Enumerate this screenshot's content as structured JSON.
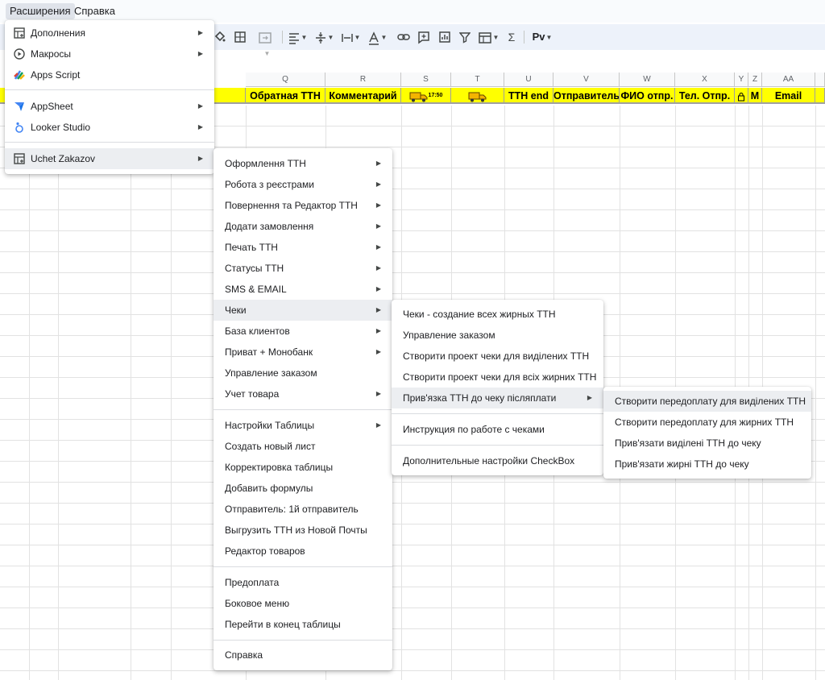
{
  "menubar": {
    "extensions": "Расширения",
    "help": "Справка"
  },
  "toolbar": {
    "format_text": "Рv"
  },
  "columns": {
    "headers": [
      "Q",
      "R",
      "S",
      "T",
      "U",
      "V",
      "W",
      "X",
      "Y",
      "Z",
      "AA"
    ],
    "header_values": [
      "Обратная ТТН",
      "Комментарий",
      "17:50",
      "",
      "ТТН end",
      "Отправитель",
      "ФИО отпр.",
      "Тел. Отпр.",
      "",
      "М",
      "Email"
    ]
  },
  "colors": {
    "header_fill": "#ffff00",
    "menu_highlight": "#eceef1"
  },
  "ext_menu": {
    "items": [
      {
        "label": "Дополнения",
        "icon": "addon-icon",
        "submenu": true
      },
      {
        "label": "Макросы",
        "icon": "macro-icon",
        "submenu": true
      },
      {
        "label": "Apps Script",
        "icon": "apps-script-icon",
        "submenu": false
      },
      {
        "label": "AppSheet",
        "icon": "appsheet-icon",
        "submenu": true
      },
      {
        "label": "Looker Studio",
        "icon": "looker-studio-icon",
        "submenu": true
      },
      {
        "label": "Uchet Zakazov",
        "icon": "addon-icon",
        "submenu": true
      }
    ]
  },
  "uchet_menu": {
    "items": [
      {
        "label": "Оформлення ТТН",
        "submenu": true
      },
      {
        "label": "Робота з реєстрами",
        "submenu": true
      },
      {
        "label": "Повернення та Редактор ТТН",
        "submenu": true
      },
      {
        "label": "Додати замовлення",
        "submenu": true
      },
      {
        "label": "Печать ТТН",
        "submenu": true
      },
      {
        "label": "Статусы ТТН",
        "submenu": true
      },
      {
        "label": "SMS & EMAIL",
        "submenu": true
      },
      {
        "label": "Чеки",
        "submenu": true
      },
      {
        "label": "База клиентов",
        "submenu": true
      },
      {
        "label": "Приват + Монобанк",
        "submenu": true
      },
      {
        "label": "Управление заказом",
        "submenu": false
      },
      {
        "label": "Учет товара",
        "submenu": true
      },
      {
        "label": "Настройки Таблицы",
        "submenu": true
      },
      {
        "label": "Создать новый лист",
        "submenu": false
      },
      {
        "label": "Корректировка таблицы",
        "submenu": false
      },
      {
        "label": "Добавить формулы",
        "submenu": false
      },
      {
        "label": "Отправитель: 1й отправитель",
        "submenu": false
      },
      {
        "label": "Выгрузить ТТН из Новой Почты",
        "submenu": false
      },
      {
        "label": "Редактор товаров",
        "submenu": false
      },
      {
        "label": "Предоплата",
        "submenu": false
      },
      {
        "label": "Боковое меню",
        "submenu": false
      },
      {
        "label": "Перейти в конец таблицы",
        "submenu": false
      },
      {
        "label": "Справка",
        "submenu": false
      }
    ]
  },
  "cheki_menu": {
    "items": [
      {
        "label": "Чеки - создание всех жирных ТТН",
        "submenu": false
      },
      {
        "label": "Управление заказом",
        "submenu": false
      },
      {
        "label": "Створити проект чеки для виділених ТТН",
        "submenu": false
      },
      {
        "label": "Створити проект чеки для всіх жирних ТТН",
        "submenu": false
      },
      {
        "label": "Прив'язка ТТН до чеку післяплати",
        "submenu": true
      },
      {
        "label": "Инструкция по работе с чеками",
        "submenu": false
      },
      {
        "label": "Дополнительные настройки CheckBox",
        "submenu": false
      }
    ]
  },
  "privyazka_menu": {
    "items": [
      {
        "label": "Створити передоплату для виділених ТТН"
      },
      {
        "label": "Створити передоплату для жирних ТТН"
      },
      {
        "label": "Прив'язати виділені ТТН до чеку"
      },
      {
        "label": "Прив'язати жирні ТТН до чеку"
      }
    ]
  }
}
